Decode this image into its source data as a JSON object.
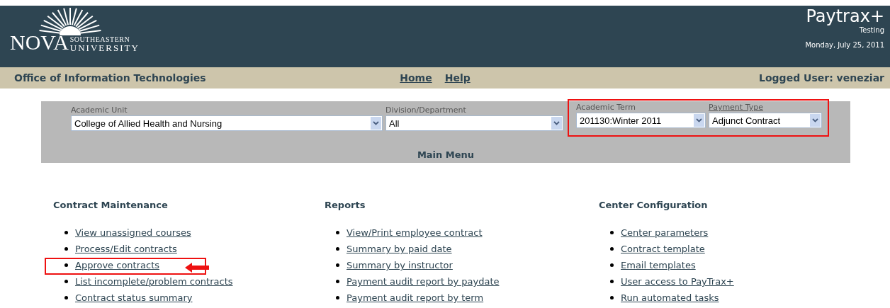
{
  "header": {
    "logo": {
      "word": "NOVA",
      "line_1": "SOUTHEASTERN",
      "line_2": "UNIVERSITY"
    },
    "app_title": "Paytrax+",
    "environment": "Testing",
    "date": "Monday, July 25, 2011"
  },
  "nav_bar": {
    "office": "Office of Information Technologies",
    "links": [
      "Home",
      "Help"
    ],
    "user": "Logged User: veneziar"
  },
  "filters": [
    {
      "label": "Academic Unit",
      "underlined": false,
      "value": "College of Allied Health and Nursing",
      "highlighted": false
    },
    {
      "label": "Division/Department",
      "underlined": false,
      "value": "All",
      "highlighted": false
    },
    {
      "label": "Academic Term",
      "underlined": false,
      "value": "201130:Winter 2011",
      "highlighted": true
    },
    {
      "label": "Payment Type",
      "underlined": true,
      "value": "Adjunct Contract",
      "highlighted": true
    }
  ],
  "panel_title": "Main Menu",
  "sections": [
    {
      "title": "Contract Maintenance",
      "items": [
        {
          "label": "View unassigned courses",
          "highlighted": false,
          "pointer": false
        },
        {
          "label": "Process/Edit contracts",
          "highlighted": false,
          "pointer": false
        },
        {
          "label": "Approve contracts",
          "highlighted": true,
          "pointer": true
        },
        {
          "label": "List incomplete/problem contracts",
          "highlighted": false,
          "pointer": false
        },
        {
          "label": "Contract status summary",
          "highlighted": false,
          "pointer": false
        }
      ]
    },
    {
      "title": "Reports",
      "items": [
        {
          "label": "View/Print employee contract",
          "highlighted": false,
          "pointer": false
        },
        {
          "label": "Summary by paid date",
          "highlighted": false,
          "pointer": false
        },
        {
          "label": "Summary by instructor",
          "highlighted": false,
          "pointer": false
        },
        {
          "label": "Payment audit report by paydate",
          "highlighted": false,
          "pointer": false
        },
        {
          "label": "Payment audit report by term",
          "highlighted": false,
          "pointer": false
        }
      ]
    },
    {
      "title": "Center Configuration",
      "items": [
        {
          "label": "Center parameters",
          "highlighted": false,
          "pointer": false
        },
        {
          "label": "Contract template",
          "highlighted": false,
          "pointer": false
        },
        {
          "label": "Email templates",
          "highlighted": false,
          "pointer": false
        },
        {
          "label": "User access to PayTrax+",
          "highlighted": false,
          "pointer": false
        },
        {
          "label": "Run automated tasks",
          "highlighted": false,
          "pointer": false
        }
      ]
    }
  ]
}
